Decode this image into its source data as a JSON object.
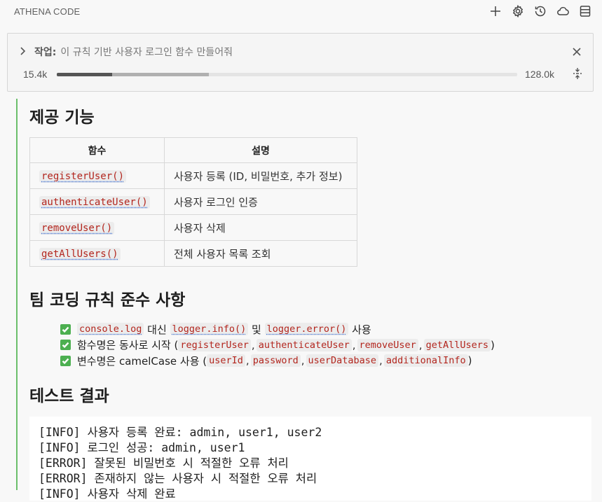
{
  "app": {
    "title": "ATHENA CODE"
  },
  "task": {
    "label": "작업:",
    "text": "이 규칙 기반 사용자 로그인 함수 만들어줘",
    "tokens_used": "15.4k",
    "tokens_max": "128.0k",
    "usage_fraction": 0.12,
    "cache_fraction": 0.33
  },
  "features": {
    "heading": "제공 기능",
    "columns": [
      "함수",
      "설명"
    ],
    "rows": [
      {
        "fn": "registerUser()",
        "desc": "사용자 등록 (ID, 비밀번호, 추가 정보)"
      },
      {
        "fn": "authenticateUser()",
        "desc": "사용자 로그인 인증"
      },
      {
        "fn": "removeUser()",
        "desc": "사용자 삭제"
      },
      {
        "fn": "getAllUsers()",
        "desc": "전체 사용자 목록 조회"
      }
    ]
  },
  "rules": {
    "heading": "팀 코딩 규칙 준수 사항",
    "item1": {
      "code_a": "console.log",
      "text_a": " 대신 ",
      "code_b": "logger.info()",
      "text_b": " 및 ",
      "code_c": "logger.error()",
      "text_c": " 사용"
    },
    "item2": {
      "text_a": "함수명은 동사로 시작 (",
      "codes": [
        "registerUser",
        "authenticateUser",
        "removeUser",
        "getAllUsers"
      ],
      "text_b": ")"
    },
    "item3": {
      "text_a": "변수명은 camelCase 사용 (",
      "codes": [
        "userId",
        "password",
        "userDatabase",
        "additionalInfo"
      ],
      "text_b": ")"
    },
    "separator": ","
  },
  "tests": {
    "heading": "테스트 결과",
    "lines": [
      "[INFO] 사용자 등록 완료: admin, user1, user2",
      "[INFO] 로그인 성공: admin, user1",
      "[ERROR] 잘못된 비밀번호 시 적절한 오류 처리",
      "[ERROR] 존재하지 않는 사용자 시 적절한 오류 처리",
      "[INFO] 사용자 삭제 완료"
    ]
  },
  "icons": {
    "toolbar": [
      "plus-icon",
      "gear-icon",
      "history-icon",
      "cloud-icon",
      "layout-icon"
    ],
    "check_color": "#4caf50",
    "accent_line": "#6cbf6c"
  }
}
